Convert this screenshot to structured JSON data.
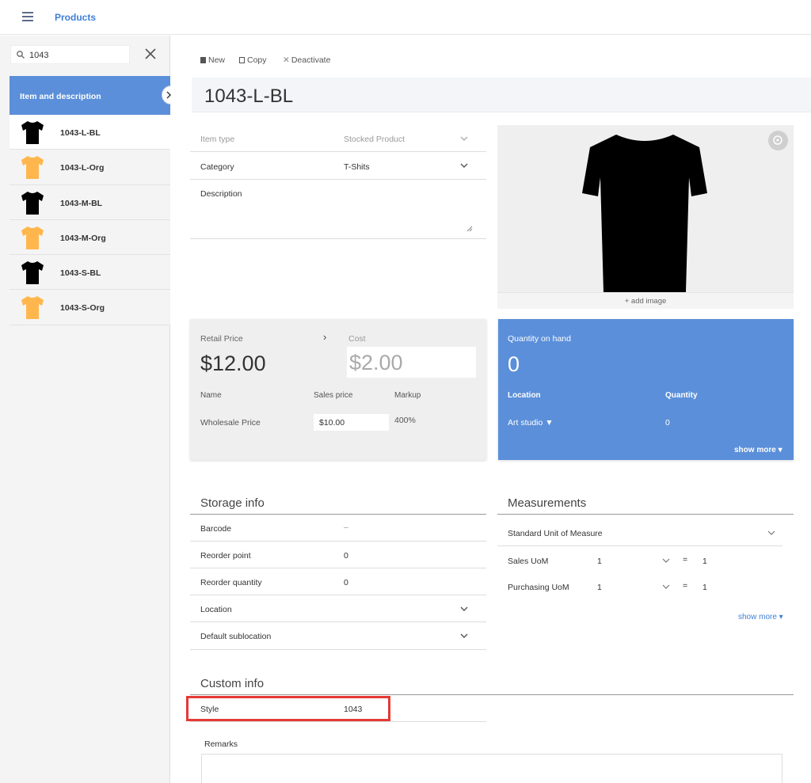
{
  "app": {
    "title": "Products"
  },
  "search": {
    "value": "1043"
  },
  "list": {
    "header": "Item and description",
    "items": [
      {
        "label": "1043-L-BL",
        "color": "black",
        "active": true
      },
      {
        "label": "1043-L-Org",
        "color": "orange",
        "active": false
      },
      {
        "label": "1043-M-BL",
        "color": "black",
        "active": false
      },
      {
        "label": "1043-M-Org",
        "color": "orange",
        "active": false
      },
      {
        "label": "1043-S-BL",
        "color": "black",
        "active": false
      },
      {
        "label": "1043-S-Org",
        "color": "orange",
        "active": false
      }
    ]
  },
  "toolbar": {
    "new": "New",
    "copy": "Copy",
    "deactivate": "Deactivate"
  },
  "product": {
    "title": "1043-L-BL",
    "item_type_label": "Item type",
    "item_type_value": "Stocked Product",
    "category_label": "Category",
    "category_value": "T-Shits",
    "description_label": "Description",
    "add_image": "+ add image"
  },
  "pricing": {
    "retail_label": "Retail Price",
    "retail_value": "$12.00",
    "cost_label": "Cost",
    "cost_value": "$2.00",
    "col_name": "Name",
    "col_sales_price": "Sales price",
    "col_markup": "Markup",
    "row_name": "Wholesale Price",
    "row_price": "$10.00",
    "row_markup": "400%"
  },
  "quantity": {
    "title": "Quantity on hand",
    "value": "0",
    "col_location": "Location",
    "col_quantity": "Quantity",
    "location": "Art studio ▼",
    "location_qty": "0",
    "show_more": "show more ▾"
  },
  "storage": {
    "title": "Storage info",
    "barcode_label": "Barcode",
    "barcode_value": "–",
    "reorder_point_label": "Reorder point",
    "reorder_point_value": "0",
    "reorder_qty_label": "Reorder quantity",
    "reorder_qty_value": "0",
    "location_label": "Location",
    "sublocation_label": "Default sublocation"
  },
  "measurements": {
    "title": "Measurements",
    "uom_label": "Standard Unit of Measure",
    "sales_uom_label": "Sales UoM",
    "sales_uom_value": "1",
    "sales_uom_eq": "=",
    "sales_uom_right": "1",
    "purchasing_uom_label": "Purchasing UoM",
    "purchasing_uom_value": "1",
    "purchasing_uom_eq": "=",
    "purchasing_uom_right": "1",
    "show_more": "show more ▾"
  },
  "custom": {
    "title": "Custom info",
    "style_label": "Style",
    "style_value": "1043",
    "remarks_label": "Remarks"
  },
  "colors": {
    "accent": "#5b8fd9",
    "link": "#3f7fd6",
    "highlight": "#e53935",
    "orange_shirt": "#ffb74d"
  }
}
